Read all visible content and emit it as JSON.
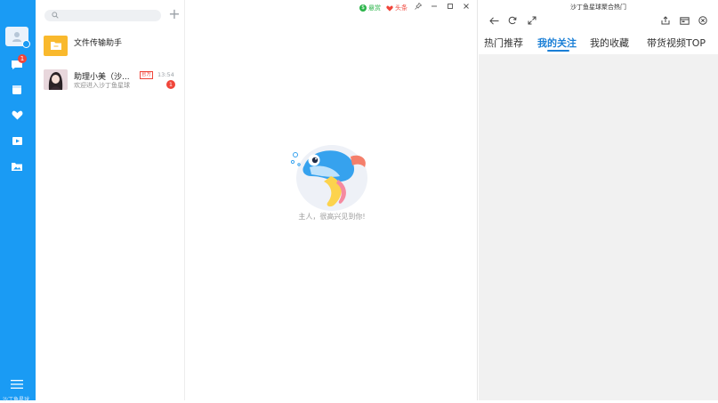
{
  "rail": {
    "items": [
      {
        "icon": "chat-bubble-icon"
      },
      {
        "icon": "contacts-card-icon"
      },
      {
        "icon": "heart-icon"
      },
      {
        "icon": "video-icon"
      },
      {
        "icon": "folder-image-icon"
      }
    ],
    "chat_badge": "1",
    "brand": "沙丁鱼星球"
  },
  "conversations": [
    {
      "name": "文件传输助手",
      "icon": "folder-icon"
    },
    {
      "name": "助理小美（沙...",
      "tag": "官方",
      "time": "13:54",
      "preview": "欢迎进入沙丁鱼星球",
      "unread": "1"
    }
  ],
  "chat": {
    "topbar": {
      "reward": "悬赏",
      "headline": "头条"
    },
    "welcome": "主人，很高兴见到你!"
  },
  "panel": {
    "title": "沙丁鱼星球聚合热门",
    "tabs": [
      "热门推荐",
      "我的关注",
      "我的收藏",
      "带货视频TOP"
    ],
    "active_tab": "我的关注"
  },
  "colors": {
    "accent": "#1a9bf4",
    "badge": "#f0453a",
    "reward": "#2bb44a"
  }
}
